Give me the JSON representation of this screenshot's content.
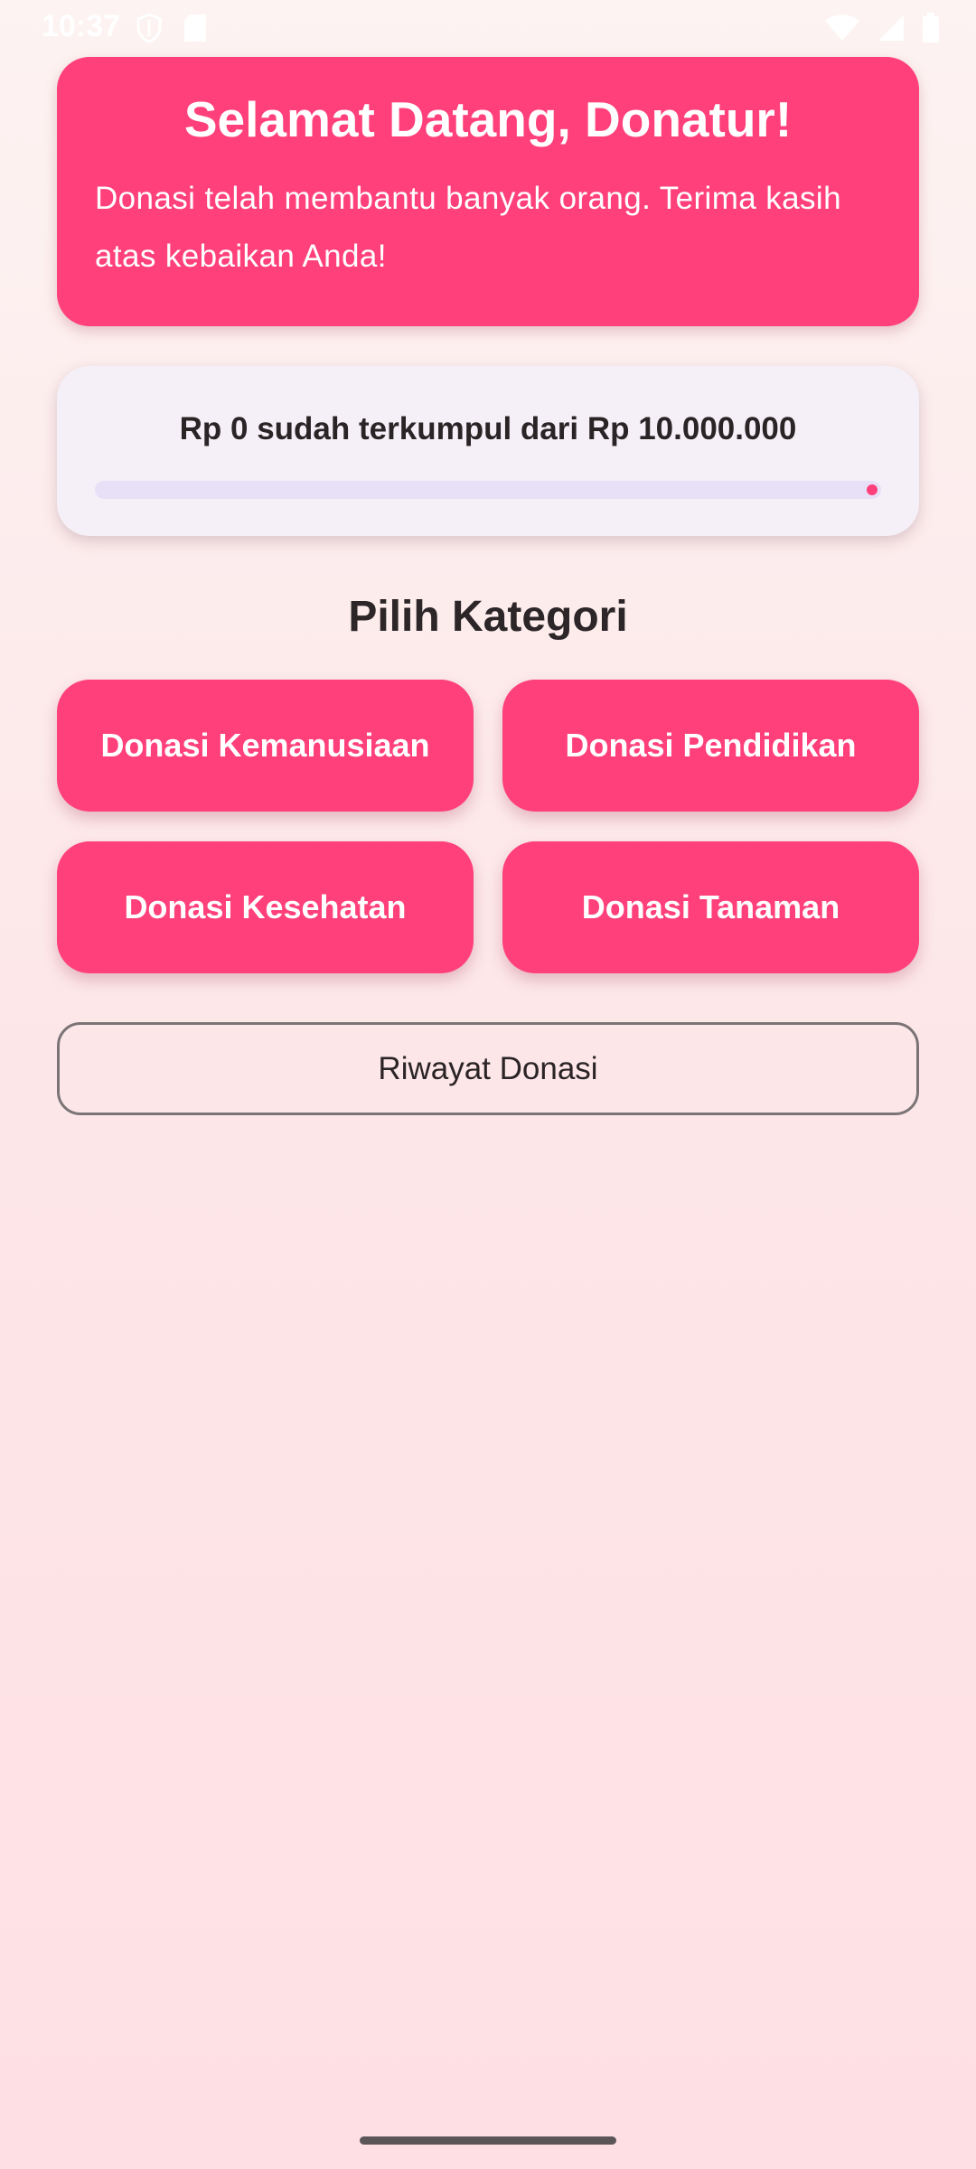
{
  "status_bar": {
    "time": "10:37",
    "left_icons": [
      "shield-icon",
      "sd-card-icon"
    ],
    "right_icons": [
      "wifi-icon",
      "signal-icon",
      "battery-icon"
    ]
  },
  "welcome": {
    "title": "Selamat Datang, Donatur!",
    "message": "Donasi telah membantu banyak orang. Terima kasih atas kebaikan Anda!"
  },
  "progress": {
    "label": "Rp 0 sudah terkumpul dari Rp 10.000.000",
    "collected": 0,
    "target": 10000000,
    "fraction": 0
  },
  "categories": {
    "title": "Pilih Kategori",
    "items": [
      {
        "label": "Donasi Kemanusiaan"
      },
      {
        "label": "Donasi Pendidikan"
      },
      {
        "label": "Donasi Kesehatan"
      },
      {
        "label": "Donasi Tanaman"
      }
    ]
  },
  "history_button": {
    "label": "Riwayat Donasi"
  },
  "colors": {
    "accent": "#ff407b",
    "track": "#e7e0f7",
    "card": "#f5f0f7"
  }
}
